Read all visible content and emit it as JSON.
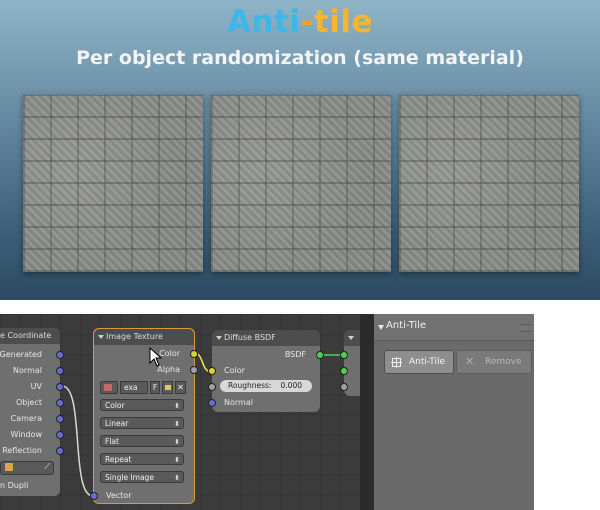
{
  "banner": {
    "title_parts": [
      "Anti",
      "-",
      "tile"
    ],
    "subtitle": "Per object randomization (same material)",
    "title_colors": {
      "anti": "#3fb6e8",
      "dash": "#f2a21f",
      "tile": "#f5b52c"
    }
  },
  "node_editor": {
    "tex_coord": {
      "title": "e Coordinate",
      "outputs": [
        "Generated",
        "Normal",
        "UV",
        "Object",
        "Camera",
        "Window",
        "Reflection"
      ],
      "bottom_label": "n Dupli"
    },
    "image_texture": {
      "title": "Image Texture",
      "outputs": [
        "Color",
        "Alpha"
      ],
      "image_name": "exa",
      "image_flag": "F",
      "dropdowns": [
        "Color",
        "Linear",
        "Flat",
        "Repeat",
        "Single Image"
      ],
      "input": "Vector"
    },
    "diffuse": {
      "title": "Diffuse BSDF",
      "output": "BSDF",
      "inputs": [
        "Color",
        "Normal"
      ],
      "roughness_label": "Roughness:",
      "roughness_value": "0.000"
    }
  },
  "panel": {
    "title": "Anti-Tile",
    "add_button": "Anti-Tile",
    "remove_button": "Remove"
  },
  "icons": [
    "collapse-triangle-icon",
    "add-icon",
    "remove-icon",
    "cursor-icon",
    "image-icon",
    "folder-icon",
    "close-icon",
    "eyedropper-icon",
    "cube-icon"
  ]
}
